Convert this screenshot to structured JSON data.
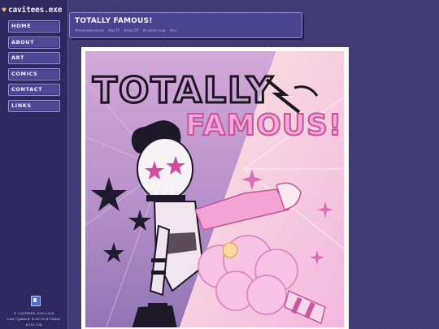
{
  "site": {
    "logo_text": "cavitees.exe"
  },
  "nav": {
    "items": [
      {
        "label": "HOME"
      },
      {
        "label": "ABOUT"
      },
      {
        "label": "ART"
      },
      {
        "label": "COMICS"
      },
      {
        "label": "CONTACT"
      },
      {
        "label": "LINKS"
      }
    ]
  },
  "footer": {
    "copyright": "© CAVITEES 2016-2024",
    "updated": "Last Updated: 4-24-2024  Visitor #151,334"
  },
  "post": {
    "title": "TOTALLY FAMOUS!",
    "tags": [
      "#monsterverse",
      "#ocTF",
      "#slasTF",
      "#comm-cop",
      "#cc"
    ]
  },
  "artwork": {
    "title_line1": "TOTALLY",
    "title_line2": "FAMOUS!"
  },
  "colors": {
    "background": "#3d3672",
    "sidebar": "#2f2860",
    "button": "#4f4894",
    "art_pink": "#f08ad8",
    "art_purple": "#8a62b8"
  }
}
